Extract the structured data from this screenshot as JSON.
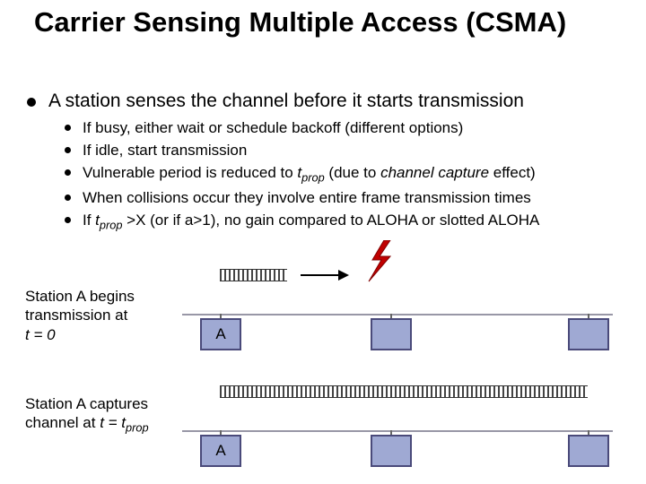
{
  "title": "Carrier Sensing Multiple Access (CSMA)",
  "bullet1": "A station senses the channel before it starts transmission",
  "sub": {
    "s1": "If busy, either wait or schedule backoff (different options)",
    "s2": "If idle, start transmission",
    "s3_pre": "Vulnerable period is reduced to ",
    "s3_tvar": "t",
    "s3_sub": "prop",
    "s3_mid": " (due to ",
    "s3_ital": "channel capture",
    "s3_post": " effect)",
    "s4": "When collisions occur they involve entire frame transmission times",
    "s5_pre": "If ",
    "s5_tvar": "t",
    "s5_sub": "prop",
    "s5_post": " >X (or if a>1), no gain compared to ALOHA or slotted ALOHA"
  },
  "cap1_l1": "Station A begins",
  "cap1_l2": "transmission at",
  "cap1_l3_pre": "",
  "cap1_l3_ital": "t = 0",
  "cap2_l1": "Station A captures",
  "cap2_l2_pre": "channel at ",
  "cap2_l2_ital1": "t = t",
  "cap2_l2_sub": "prop",
  "boxA": "A",
  "boxB": "",
  "boxC": ""
}
